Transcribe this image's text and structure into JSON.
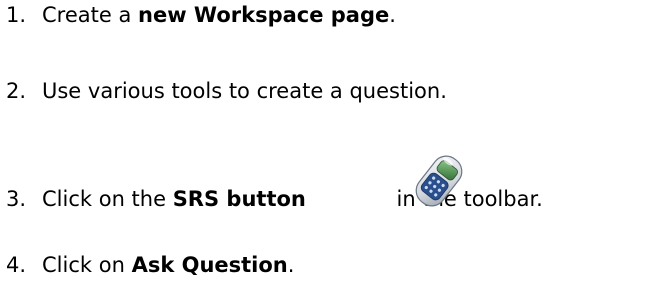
{
  "steps": [
    {
      "number": "1.",
      "before": "Create a ",
      "bold": "new Workspace page",
      "after": "."
    },
    {
      "number": "2.",
      "text": "Use various tools to create a question."
    },
    {
      "number": "3.",
      "before": "Click on the ",
      "bold": "SRS button",
      "after": " in the toolbar."
    },
    {
      "number": "4.",
      "before": "Click on ",
      "bold": "Ask Question",
      "after": "."
    }
  ],
  "icons": {
    "srs_button": "srs-clicker-icon"
  }
}
